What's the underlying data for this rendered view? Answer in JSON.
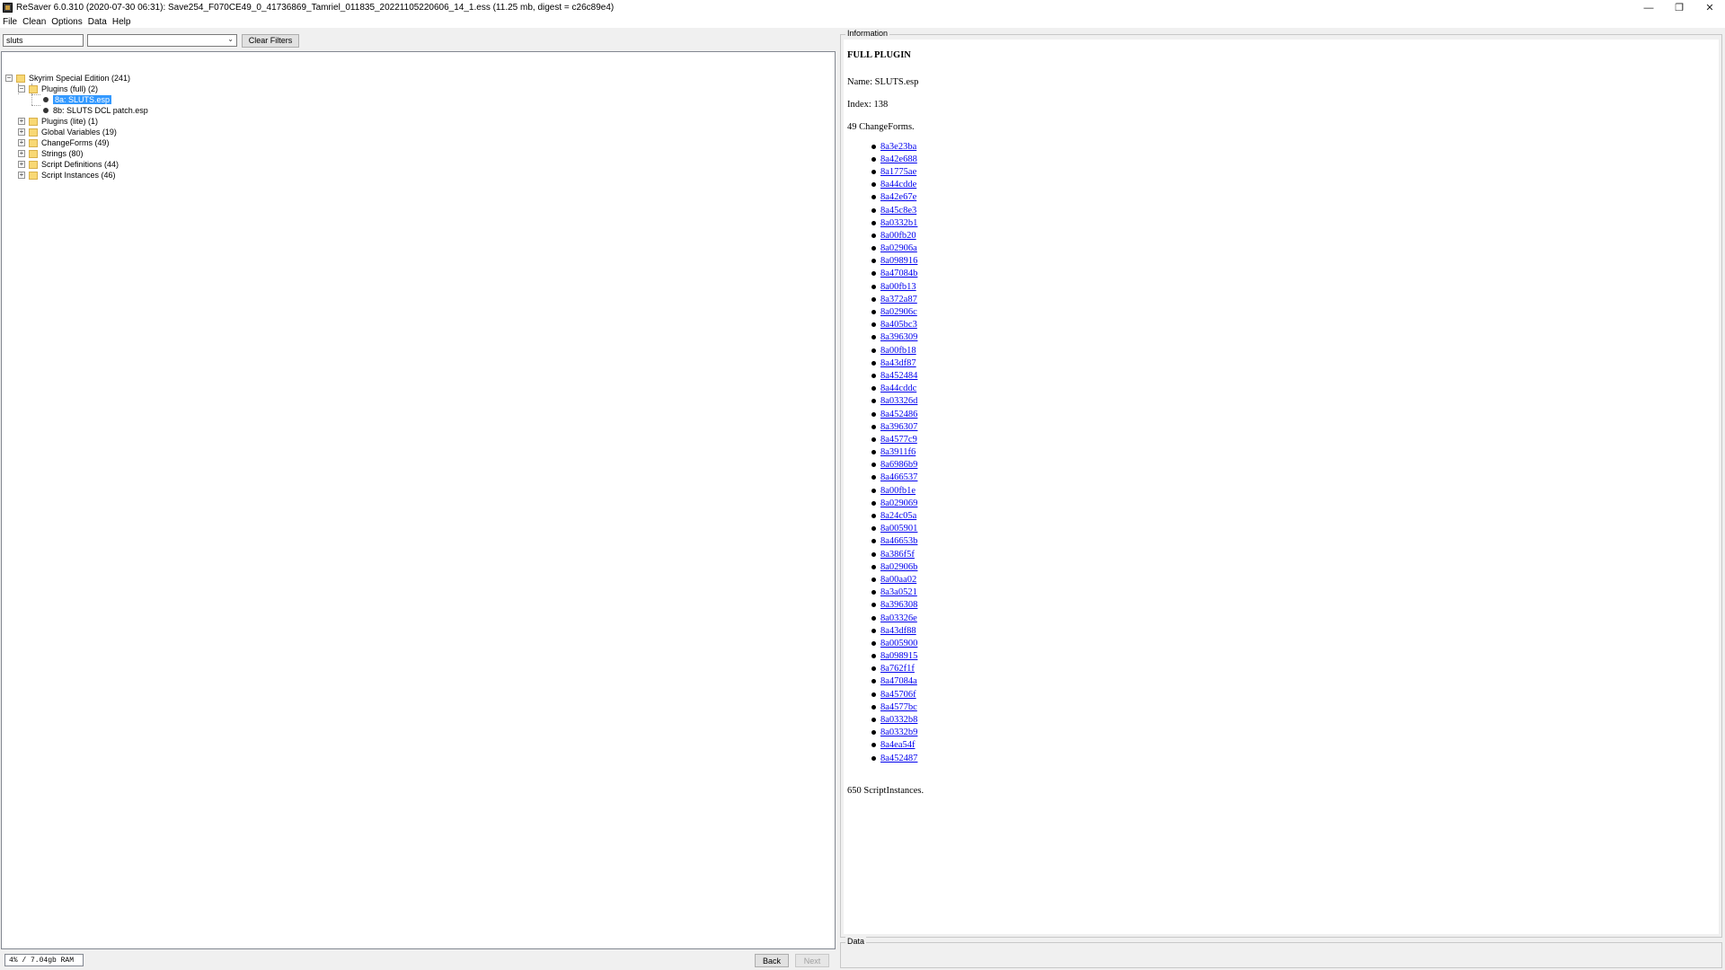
{
  "window": {
    "title": "ReSaver 6.0.310 (2020-07-30 06:31): Save254_F070CE49_0_41736869_Tamriel_011835_20221105220606_14_1.ess (11.25 mb, digest = c26c89e4)",
    "minimize": "—",
    "restore": "❐",
    "close": "✕"
  },
  "menu": {
    "file": "File",
    "clean": "Clean",
    "options": "Options",
    "data": "Data",
    "help": "Help"
  },
  "filter": {
    "search_value": "sluts",
    "select_value": "",
    "clear_label": "Clear Filters"
  },
  "tree": {
    "root": "Skyrim Special Edition (241)",
    "plugins_full": "Plugins (full) (2)",
    "plugin_1": "8a: SLUTS.esp",
    "plugin_2": "8b: SLUTS DCL patch.esp",
    "plugins_lite": "Plugins (lite) (1)",
    "global_vars": "Global Variables (19)",
    "change_forms": "ChangeForms (49)",
    "strings": "Strings (80)",
    "script_defs": "Script Definitions (44)",
    "script_instances": "Script Instances (46)"
  },
  "status": {
    "memory": "4% / 7.04gb RAM",
    "back": "Back",
    "next": "Next"
  },
  "information": {
    "group_title": "Information",
    "heading": "FULL PLUGIN",
    "name": "Name: SLUTS.esp",
    "index": "Index: 138",
    "changeforms_count": "49 ChangeForms.",
    "changeforms": [
      "8a3e23ba",
      "8a42e688",
      "8a1775ae",
      "8a44cdde",
      "8a42e67e",
      "8a45c8e3",
      "8a0332b1",
      "8a00fb20",
      "8a02906a",
      "8a098916",
      "8a47084b",
      "8a00fb13",
      "8a372a87",
      "8a02906c",
      "8a405bc3",
      "8a396309",
      "8a00fb18",
      "8a43df87",
      "8a452484",
      "8a44cddc",
      "8a03326d",
      "8a452486",
      "8a396307",
      "8a4577c9",
      "8a3911f6",
      "8a6986b9",
      "8a466537",
      "8a00fb1e",
      "8a029069",
      "8a24c05a",
      "8a005901",
      "8a46653b",
      "8a386f5f",
      "8a02906b",
      "8a00aa02",
      "8a3a0521",
      "8a396308",
      "8a03326e",
      "8a43df88",
      "8a005900",
      "8a098915",
      "8a762f1f",
      "8a47084a",
      "8a45706f",
      "8a4577bc",
      "8a0332b8",
      "8a0332b9",
      "8a4ea54f",
      "8a452487"
    ],
    "script_instances": "650 ScriptInstances."
  },
  "data_panel": {
    "group_title": "Data"
  },
  "colors": {
    "selection": "#3399ff",
    "link": "#0000ee",
    "folder": "#f8d874"
  }
}
